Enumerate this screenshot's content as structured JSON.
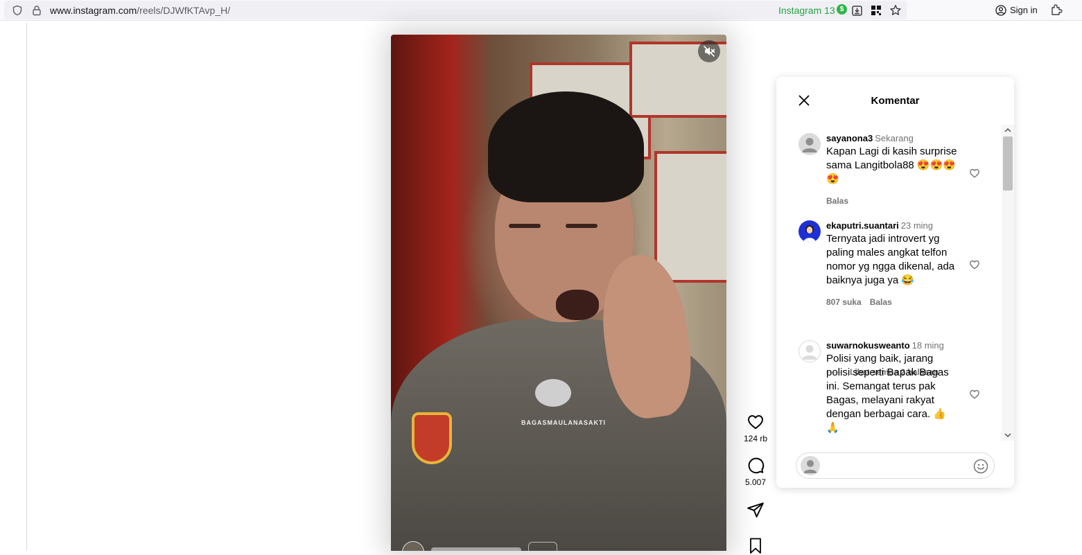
{
  "browser": {
    "url_host": "www.instagram.com",
    "url_path": "/reels/DJWfKTAvp_H/",
    "extension_label": "Instagram 13",
    "extension_badge": "$",
    "signin_label": "Sign in"
  },
  "video": {
    "watermark": "BAGASMAULANASAKTI"
  },
  "actions": {
    "likes": "124 rb",
    "comments": "5.007"
  },
  "panel": {
    "title": "Komentar",
    "comments": [
      {
        "user": "sayanona3",
        "time": "Sekarang",
        "text": "Kapan Lagi di kasih surprise sama Langitbola88 😍😍😍😍",
        "likes": "",
        "reply": "Balas"
      },
      {
        "user": "ekaputri.suantari",
        "time": "23 ming",
        "text": "Ternyata jadi introvert yg paling males angkat telfon nomor yg ngga dikenal, ada baiknya juga ya 😂",
        "likes": "807 suka",
        "reply": "Balas"
      },
      {
        "user": "suwarnokusweanto",
        "time": "18 ming",
        "text": "Polisi yang baik, jarang polisi seperti Bapak Bagas ini. Semangat terus pak Bagas, melayani rakyat dengan berbagai cara. 👍🙏",
        "likes": "",
        "reply": ""
      }
    ],
    "view_replies": "Lihat semua 2 balasan",
    "composer_placeholder": ""
  },
  "colors": {
    "extension_green": "#25a244",
    "muted_text": "#737373",
    "avatar_blue": "#1f2fd6"
  }
}
